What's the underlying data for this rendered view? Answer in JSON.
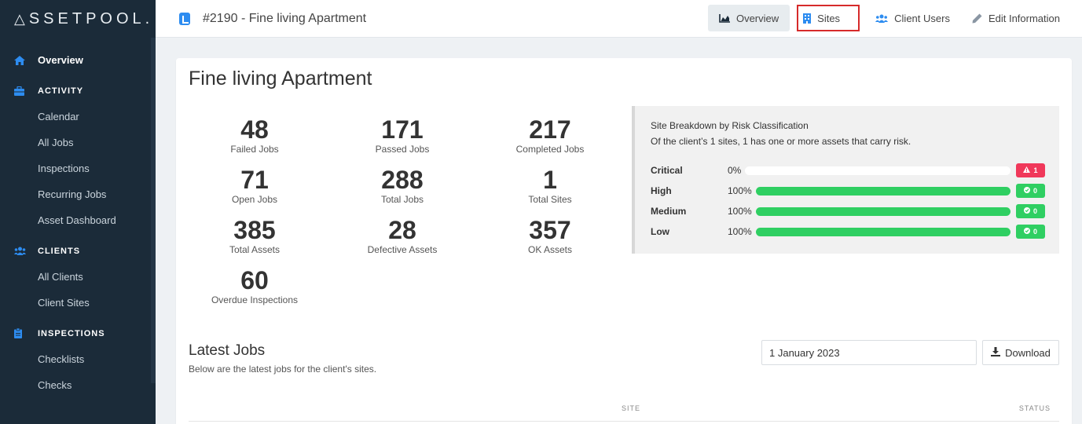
{
  "sidebar": {
    "logo": "SSETPOOL.",
    "items": [
      {
        "label": "Overview",
        "icon": "home-icon"
      },
      {
        "section": "ACTIVITY",
        "icon": "briefcase-icon"
      },
      {
        "label": "Calendar"
      },
      {
        "label": "All Jobs"
      },
      {
        "label": "Inspections"
      },
      {
        "label": "Recurring Jobs"
      },
      {
        "label": "Asset Dashboard"
      },
      {
        "section": "CLIENTS",
        "icon": "users-icon"
      },
      {
        "label": "All Clients"
      },
      {
        "label": "Client Sites"
      },
      {
        "section": "INSPECTIONS",
        "icon": "clipboard-icon"
      },
      {
        "label": "Checklists"
      },
      {
        "label": "Checks"
      }
    ]
  },
  "header": {
    "title": "#2190 - Fine living Apartment",
    "nav": {
      "overview": "Overview",
      "sites": "Sites",
      "client_users": "Client Users",
      "edit_information": "Edit Information"
    }
  },
  "main": {
    "title": "Fine living Apartment",
    "stats": [
      {
        "value": "48",
        "label": "Failed Jobs"
      },
      {
        "value": "171",
        "label": "Passed Jobs"
      },
      {
        "value": "217",
        "label": "Completed Jobs"
      },
      {
        "value": "71",
        "label": "Open Jobs"
      },
      {
        "value": "288",
        "label": "Total Jobs"
      },
      {
        "value": "1",
        "label": "Total Sites"
      },
      {
        "value": "385",
        "label": "Total Assets"
      },
      {
        "value": "28",
        "label": "Defective Assets"
      },
      {
        "value": "357",
        "label": "OK Assets"
      },
      {
        "value": "60",
        "label": "Overdue Inspections"
      }
    ],
    "risk": {
      "heading": "Site Breakdown by Risk Classification",
      "subheading": "Of the client’s 1 sites, 1 has one or more assets that carry risk.",
      "rows": [
        {
          "name": "Critical",
          "pct_label": "0%",
          "fraction": 0,
          "badge": "1",
          "badge_color": "#f0385a",
          "badge_icon": "warning-icon"
        },
        {
          "name": "High",
          "pct_label": "100%",
          "fraction": 1,
          "badge": "0",
          "badge_color": "#2fcf62",
          "badge_icon": "check-circle-icon"
        },
        {
          "name": "Medium",
          "pct_label": "100%",
          "fraction": 1,
          "badge": "0",
          "badge_color": "#2fcf62",
          "badge_icon": "check-circle-icon"
        },
        {
          "name": "Low",
          "pct_label": "100%",
          "fraction": 1,
          "badge": "0",
          "badge_color": "#2fcf62",
          "badge_icon": "check-circle-icon"
        }
      ]
    },
    "latest": {
      "title": "Latest Jobs",
      "subtitle": "Below are the latest jobs for the client's sites.",
      "date_value": "1 January 2023",
      "download_label": "Download",
      "columns": {
        "site": "SITE",
        "status": "STATUS"
      }
    }
  },
  "colors": {
    "sidebar_bg": "#1b2b39",
    "accent_blue": "#2d8cf0",
    "success": "#2fcf62",
    "danger": "#f0385a",
    "highlight": "#d62a2a"
  }
}
